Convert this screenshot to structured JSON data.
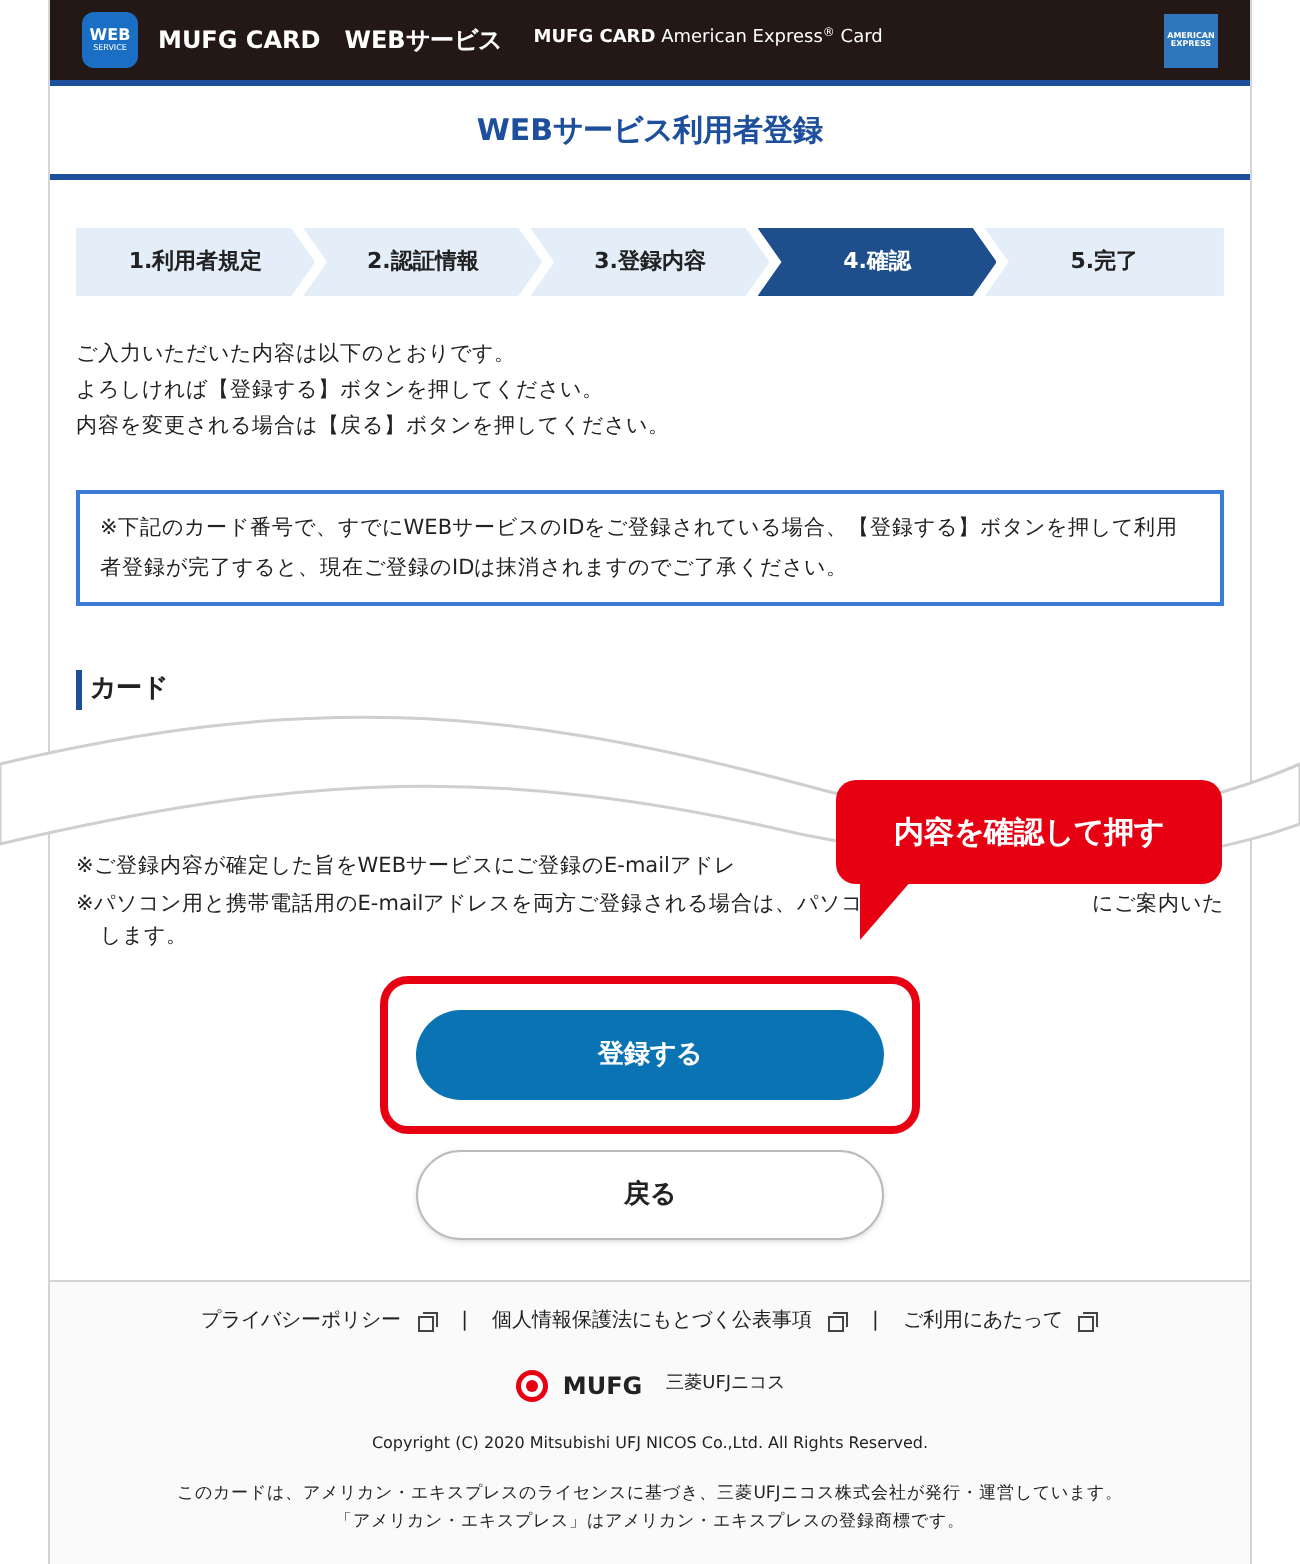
{
  "header": {
    "logo_lines": [
      "WEB",
      "SERVICE"
    ],
    "brand": "MUFG CARD　WEBサービス",
    "sub_brand": "MUFG CARD",
    "sub_brand_rest": "American Express",
    "sub_brand_mark": "®",
    "sub_brand_end": "Card",
    "amex_lines": [
      "AMERICAN",
      "EXPRESS"
    ]
  },
  "page_title": "WEBサービス利用者登録",
  "steps": [
    {
      "label": "1.利用者規定",
      "selected": false
    },
    {
      "label": "2.認証情報",
      "selected": false
    },
    {
      "label": "3.登録内容",
      "selected": false
    },
    {
      "label": "4.確認",
      "selected": true
    },
    {
      "label": "5.完了",
      "selected": false
    }
  ],
  "intro": [
    "ご入力いただいた内容は以下のとおりです。",
    "よろしければ【登録する】ボタンを押してください。",
    "内容を変更される場合は【戻る】ボタンを押してください。"
  ],
  "notice": "※下記のカード番号で、すでにWEBサービスのIDをご登録されている場合、【登録する】ボタンを押して利用者登録が完了すると、現在ご登録のIDは抹消されますのでご了承ください。",
  "section_heading": "カード",
  "notes": [
    {
      "text": "※ご登録内容が確定した旨をWEBサービスにご登録のE-mailアドレ"
    },
    {
      "text": "※パソコン用と携帯電話用のE-mailアドレスを両方ご登録される場合は、パソコ",
      "tail": "にご案内いた",
      "continuation": "します。"
    }
  ],
  "callout": "内容を確認して押す",
  "buttons": [
    {
      "label": "登録する",
      "kind": "primary"
    },
    {
      "label": "戻る",
      "kind": "secondary"
    }
  ],
  "footer": {
    "links": [
      "プライバシーポリシー",
      "個人情報保護法にもとづく公表事項",
      "ご利用にあたって"
    ],
    "separator": "|",
    "logo_text": "MUFG",
    "logo_sub": "三菱UFJニコス",
    "copyright": "Copyright (C) 2020 Mitsubishi UFJ NICOS Co.,Ltd. All Rights Reserved.",
    "disclaimer": [
      "このカードは、アメリカン・エキスプレスのライセンスに基づき、三菱UFJニコス株式会社が発行・運営しています。",
      "「アメリカン・エキスプレス」はアメリカン・エキスプレスの登録商標です。"
    ]
  }
}
